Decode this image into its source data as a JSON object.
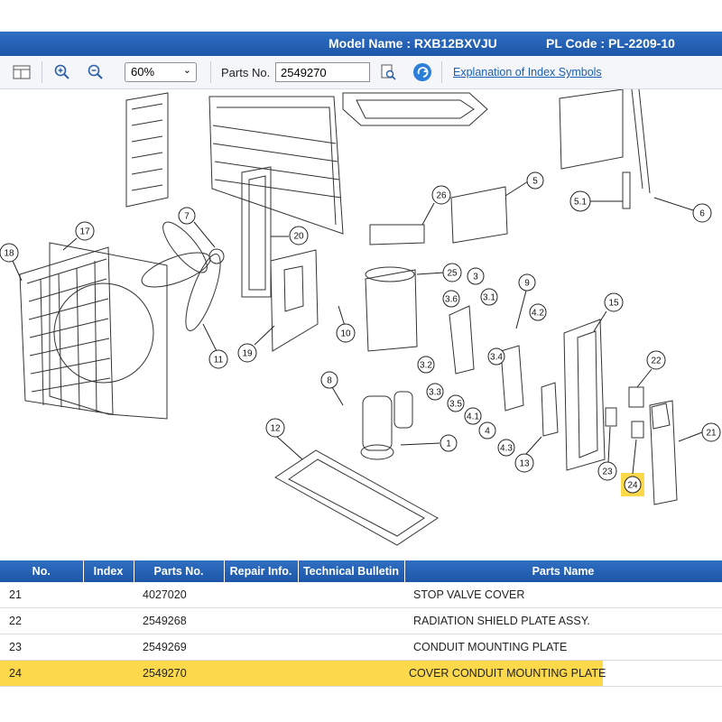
{
  "header": {
    "model_name": "Model Name : RXB12BXVJU",
    "pl_code": "PL Code : PL-2209-10"
  },
  "toolbar": {
    "zoom_value": "60%",
    "parts_no_label": "Parts No.",
    "parts_no_value": "2549270",
    "explanation_link": "Explanation of Index Symbols",
    "icons": [
      "panel-layout-icon",
      "zoom-in-icon",
      "zoom-out-icon",
      "document-search-icon",
      "refresh-icon"
    ]
  },
  "diagram": {
    "callouts": [
      "1",
      "3",
      "3.1",
      "3.2",
      "3.3",
      "3.4",
      "3.5",
      "3.6",
      "4",
      "4.1",
      "4.2",
      "4.3",
      "5",
      "5.1",
      "6",
      "7",
      "8",
      "9",
      "10",
      "11",
      "12",
      "13",
      "15",
      "17",
      "18",
      "19",
      "20",
      "21",
      "22",
      "23",
      "24",
      "25",
      "26"
    ],
    "highlight_callout": "24",
    "highlight_color": "#fcd84b"
  },
  "table": {
    "columns": [
      "No.",
      "Index",
      "Parts No.",
      "Repair Info.",
      "Technical Bulletin",
      "Parts Name"
    ],
    "rows": [
      {
        "no": "21",
        "index": "",
        "parts_no": "4027020",
        "repair": "",
        "bulletin": "",
        "name": "STOP VALVE COVER"
      },
      {
        "no": "22",
        "index": "",
        "parts_no": "2549268",
        "repair": "",
        "bulletin": "",
        "name": "RADIATION SHIELD PLATE ASSY."
      },
      {
        "no": "23",
        "index": "",
        "parts_no": "2549269",
        "repair": "",
        "bulletin": "",
        "name": "CONDUIT MOUNTING PLATE"
      },
      {
        "no": "24",
        "index": "",
        "parts_no": "2549270",
        "repair": "",
        "bulletin": "",
        "name": "COVER CONDUIT MOUNTING PLATE"
      }
    ],
    "selected_row": 3
  },
  "colors": {
    "header_blue": "#1d56a8",
    "highlight": "#fcd84b",
    "link": "#1a5fb4"
  }
}
